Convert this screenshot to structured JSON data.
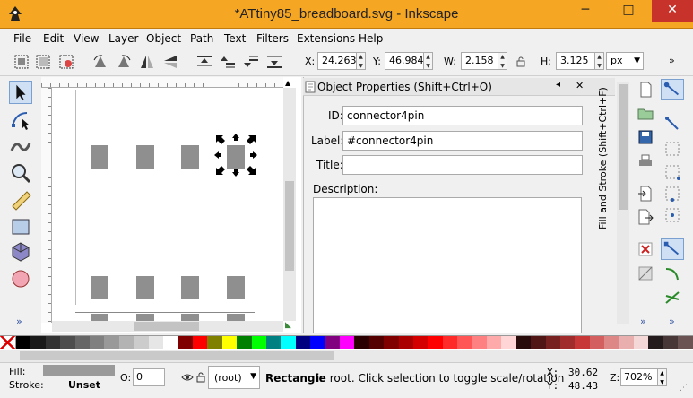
{
  "window": {
    "title": "*ATtiny85_breadboard.svg - Inkscape",
    "minimize": "─",
    "maximize": "□",
    "close": "✕"
  },
  "menu": [
    "File",
    "Edit",
    "View",
    "Layer",
    "Object",
    "Path",
    "Text",
    "Filters",
    "Extensions",
    "Help"
  ],
  "toolbar": {
    "x_label": "X:",
    "x_value": "24.263",
    "y_label": "Y:",
    "y_value": "46.984",
    "w_label": "W:",
    "w_value": "2.158",
    "h_label": "H:",
    "h_value": "3.125",
    "unit": "px"
  },
  "panel": {
    "title": "Object Properties (Shift+Ctrl+O)",
    "id_label": "ID:",
    "id_value": "connector4pin",
    "label_label": "Label:",
    "label_value": "#connector4pin",
    "title_label": "Title:",
    "title_value": "",
    "description_label": "Description:",
    "side_tab": "Fill and Stroke (Shift+Ctrl+F)"
  },
  "status": {
    "fill_label": "Fill:",
    "stroke_label": "Stroke:",
    "stroke_value": "Unset",
    "opacity_label": "O:",
    "opacity_value": "0",
    "layer": "(root)",
    "message_bold": "Rectangle",
    "message": " in root. Click selection to toggle scale/rotation",
    "x_label": "X:",
    "x_value": "30.62",
    "y_label": "Y:",
    "y_value": "48.43",
    "zoom_label": "Z:",
    "zoom_value": "702%"
  },
  "colors": {
    "titlebar": "#f5a623",
    "close": "#c7332b",
    "pad": "#8f8f8f",
    "fill_swatch": "#9a9a9a"
  },
  "palette": [
    "#000000",
    "#1a1a1a",
    "#333333",
    "#4d4d4d",
    "#666666",
    "#808080",
    "#999999",
    "#b3b3b3",
    "#cccccc",
    "#e6e6e6",
    "#ffffff",
    "#800000",
    "#ff0000",
    "#808000",
    "#ffff00",
    "#008000",
    "#00ff00",
    "#008080",
    "#00ffff",
    "#000080",
    "#0000ff",
    "#800080",
    "#ff00ff",
    "#2b0000",
    "#550000",
    "#800000",
    "#aa0000",
    "#d40000",
    "#ff0000",
    "#ff2a2a",
    "#ff5555",
    "#ff8080",
    "#ffaaaa",
    "#ffd5d5",
    "#280b0b",
    "#501616",
    "#782121",
    "#a02c2c",
    "#c83737",
    "#d35f5f",
    "#de8787",
    "#e9afaf",
    "#f4d7d7",
    "#241c1c",
    "#483737",
    "#6c5353"
  ]
}
